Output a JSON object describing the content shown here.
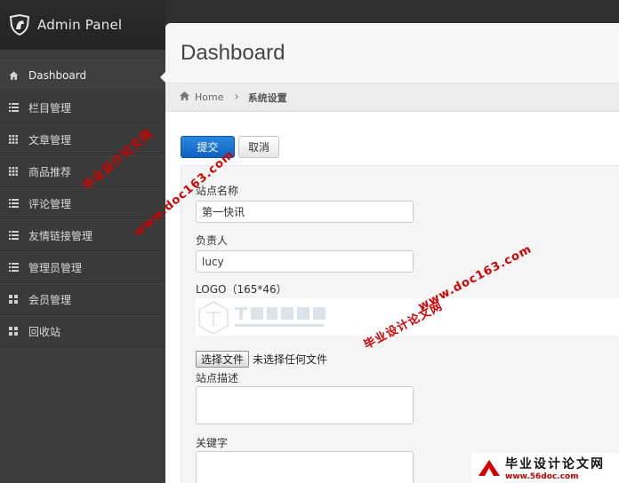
{
  "brand": {
    "title": "Admin Panel"
  },
  "sidebar": {
    "items": [
      {
        "label": "Dashboard",
        "icon": "home-icon",
        "active": true
      },
      {
        "label": "栏目管理",
        "icon": "list-icon"
      },
      {
        "label": "文章管理",
        "icon": "grid-icon"
      },
      {
        "label": "商品推荐",
        "icon": "grid-icon"
      },
      {
        "label": "评论管理",
        "icon": "list-icon"
      },
      {
        "label": "友情链接管理",
        "icon": "list-icon"
      },
      {
        "label": "管理员管理",
        "icon": "list-icon"
      },
      {
        "label": "会员管理",
        "icon": "grid-large-icon"
      },
      {
        "label": "回收站",
        "icon": "grid-large-icon"
      }
    ]
  },
  "header": {
    "title": "Dashboard"
  },
  "breadcrumb": {
    "home": "Home",
    "current": "系统设置"
  },
  "toolbar": {
    "submit_label": "提交",
    "cancel_label": "取消"
  },
  "form": {
    "site_name_label": "站点名称",
    "site_name_value": "第一快讯",
    "owner_label": "负责人",
    "owner_value": "lucy",
    "logo_label": "LOGO（165*46）",
    "file_button_label": "选择文件",
    "file_status": "未选择任何文件",
    "description_label": "站点描述",
    "keywords_label": "关键字"
  },
  "watermark": {
    "site_cn": "毕业设计论文网",
    "url": "www.doc163.com",
    "badge_url": "www.56doc.com"
  },
  "colors": {
    "accent": "#1a73d0",
    "watermark": "#d40000"
  }
}
